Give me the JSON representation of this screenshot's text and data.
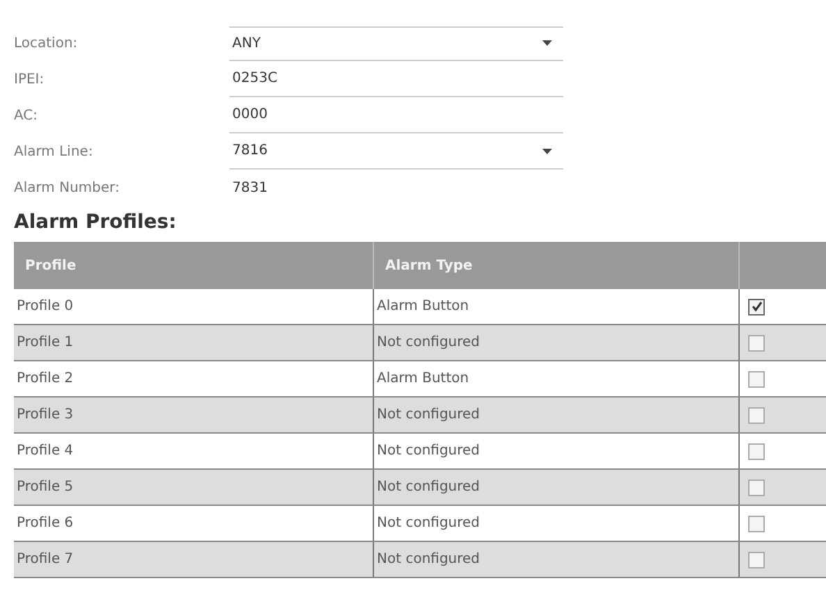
{
  "form": [
    {
      "label": "Location:",
      "kind": "select",
      "value": "ANY"
    },
    {
      "label": "IPEI:",
      "kind": "input",
      "value": "0253C"
    },
    {
      "label": "AC:",
      "kind": "input",
      "value": "0000"
    },
    {
      "label": "Alarm Line:",
      "kind": "select",
      "value": "7816"
    },
    {
      "label": "Alarm Number:",
      "kind": "text",
      "value": "7831"
    }
  ],
  "section_title": "Alarm Profiles:",
  "table": {
    "columns": [
      "Profile",
      "Alarm Type"
    ],
    "rows": [
      {
        "profile": "Profile 0",
        "alarm_type": "Alarm Button",
        "checked": true
      },
      {
        "profile": "Profile 1",
        "alarm_type": "Not configured",
        "checked": false
      },
      {
        "profile": "Profile 2",
        "alarm_type": "Alarm Button",
        "checked": false
      },
      {
        "profile": "Profile 3",
        "alarm_type": "Not configured",
        "checked": false
      },
      {
        "profile": "Profile 4",
        "alarm_type": "Not configured",
        "checked": false
      },
      {
        "profile": "Profile 5",
        "alarm_type": "Not configured",
        "checked": false
      },
      {
        "profile": "Profile 6",
        "alarm_type": "Not configured",
        "checked": false
      },
      {
        "profile": "Profile 7",
        "alarm_type": "Not configured",
        "checked": false
      }
    ]
  }
}
